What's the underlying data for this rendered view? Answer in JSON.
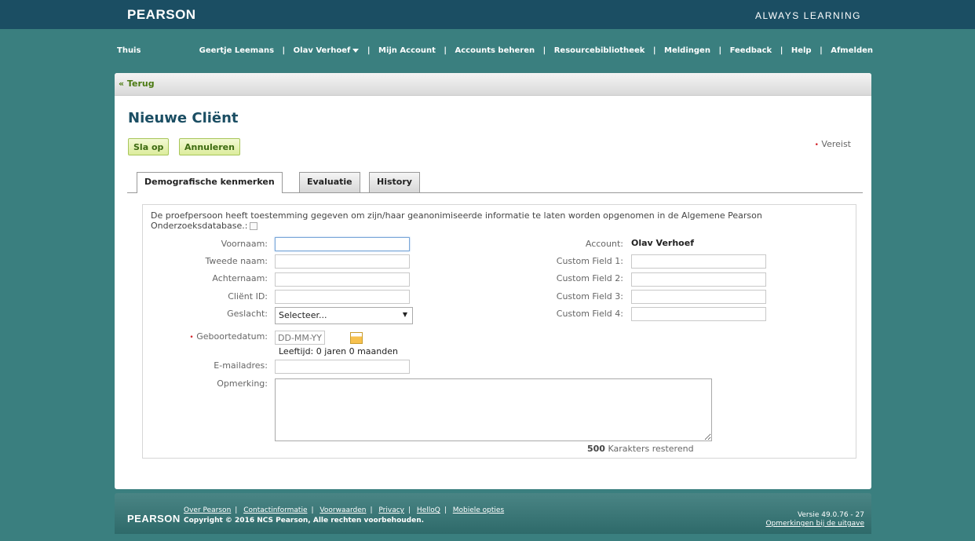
{
  "header": {
    "logo": "PEARSON",
    "tagline": "ALWAYS LEARNING"
  },
  "nav": {
    "home": "Thuis",
    "user": "Geertje Leemans",
    "account_switcher": "Olav Verhoef",
    "items": [
      "Mijn Account",
      "Accounts beheren",
      "Resourcebibliotheek",
      "Meldingen",
      "Feedback",
      "Help",
      "Afmelden"
    ],
    "separator": "|"
  },
  "back": "« Terug",
  "page": {
    "title": "Nieuwe Cliënt",
    "save_label": "Sla op",
    "cancel_label": "Annuleren",
    "required_label": "Vereist",
    "required_marker": "•"
  },
  "tabs": [
    {
      "label": "Demografische kenmerken",
      "active": true
    },
    {
      "label": "Evaluatie",
      "active": false
    },
    {
      "label": "History",
      "active": false
    }
  ],
  "form": {
    "consent_text": "De proefpersoon heeft toestemming gegeven om zijn/haar geanonimiseerde informatie te laten worden opgenomen in de Algemene Pearson Onderzoeksdatabase.:",
    "consent_checked": false,
    "first_name_label": "Voornaam:",
    "middle_name_label": "Tweede naam:",
    "last_name_label": "Achternaam:",
    "client_id_label": "Cliënt ID:",
    "gender_label": "Geslacht:",
    "gender_value": "Selecteer...",
    "dob_label": "Geboortedatum:",
    "dob_placeholder": "DD-MM-YYYY",
    "age_text": "Leeftijd: 0 jaren 0 maanden",
    "email_label": "E-mailadres:",
    "remark_label": "Opmerking:",
    "chars_count": "500",
    "chars_text": "Karakters resterend",
    "account_label": "Account:",
    "account_value": "Olav Verhoef",
    "custom1_label": "Custom Field 1:",
    "custom2_label": "Custom Field 2:",
    "custom3_label": "Custom Field 3:",
    "custom4_label": "Custom Field 4:"
  },
  "footer": {
    "logo": "PEARSON",
    "links": [
      "Over Pearson",
      "Contactinformatie",
      "Voorwaarden",
      "Privacy",
      "HelloQ",
      "Mobiele opties"
    ],
    "copyright": "Copyright © 2016 NCS Pearson, Alle rechten voorbehouden.",
    "version": "Versie 49.0.76 - 27",
    "release_notes": "Opmerkingen bij de uitgave"
  },
  "colors": {
    "background": "#3a7f7f",
    "header": "#1b4e63",
    "title": "#1b4e63",
    "button": "#dcec9c",
    "required": "#d2232a"
  }
}
